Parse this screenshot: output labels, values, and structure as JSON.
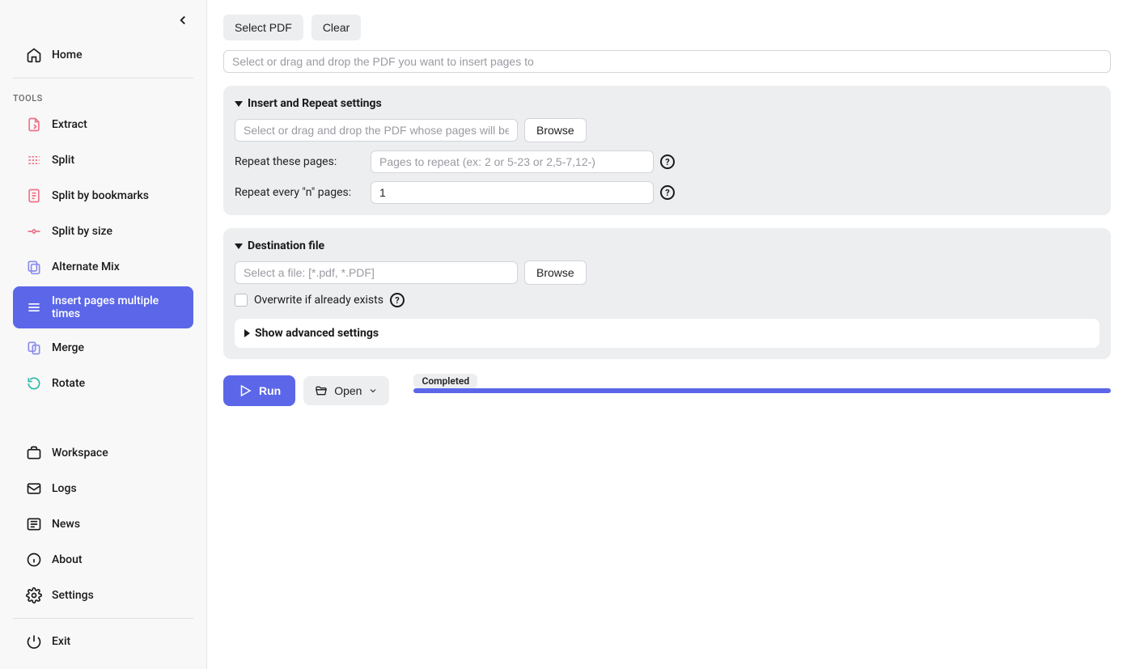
{
  "sidebar": {
    "home": "Home",
    "tools_header": "TOOLS",
    "tools": [
      {
        "label": "Extract"
      },
      {
        "label": "Split"
      },
      {
        "label": "Split by bookmarks"
      },
      {
        "label": "Split by size"
      },
      {
        "label": "Alternate Mix"
      },
      {
        "label": "Insert pages multiple times"
      },
      {
        "label": "Merge"
      },
      {
        "label": "Rotate"
      }
    ],
    "workspace": "Workspace",
    "logs": "Logs",
    "news": "News",
    "about": "About",
    "settings": "Settings",
    "exit": "Exit"
  },
  "toolbar": {
    "select_pdf": "Select PDF",
    "clear": "Clear"
  },
  "main_input_placeholder": "Select or drag and drop the PDF you want to insert pages to",
  "insert_panel": {
    "title": "Insert and Repeat settings",
    "source_placeholder": "Select or drag and drop the PDF whose pages will be repeated",
    "browse": "Browse",
    "repeat_pages_label": "Repeat these pages:",
    "repeat_pages_placeholder": "Pages to repeat (ex: 2 or 5-23 or 2,5-7,12-)",
    "repeat_every_label": "Repeat every \"n\" pages:",
    "repeat_every_value": "1"
  },
  "dest_panel": {
    "title": "Destination file",
    "placeholder": "Select a file: [*.pdf, *.PDF]",
    "browse": "Browse",
    "overwrite": "Overwrite if already exists",
    "advanced": "Show advanced settings"
  },
  "actions": {
    "run": "Run",
    "open": "Open",
    "status": "Completed"
  }
}
